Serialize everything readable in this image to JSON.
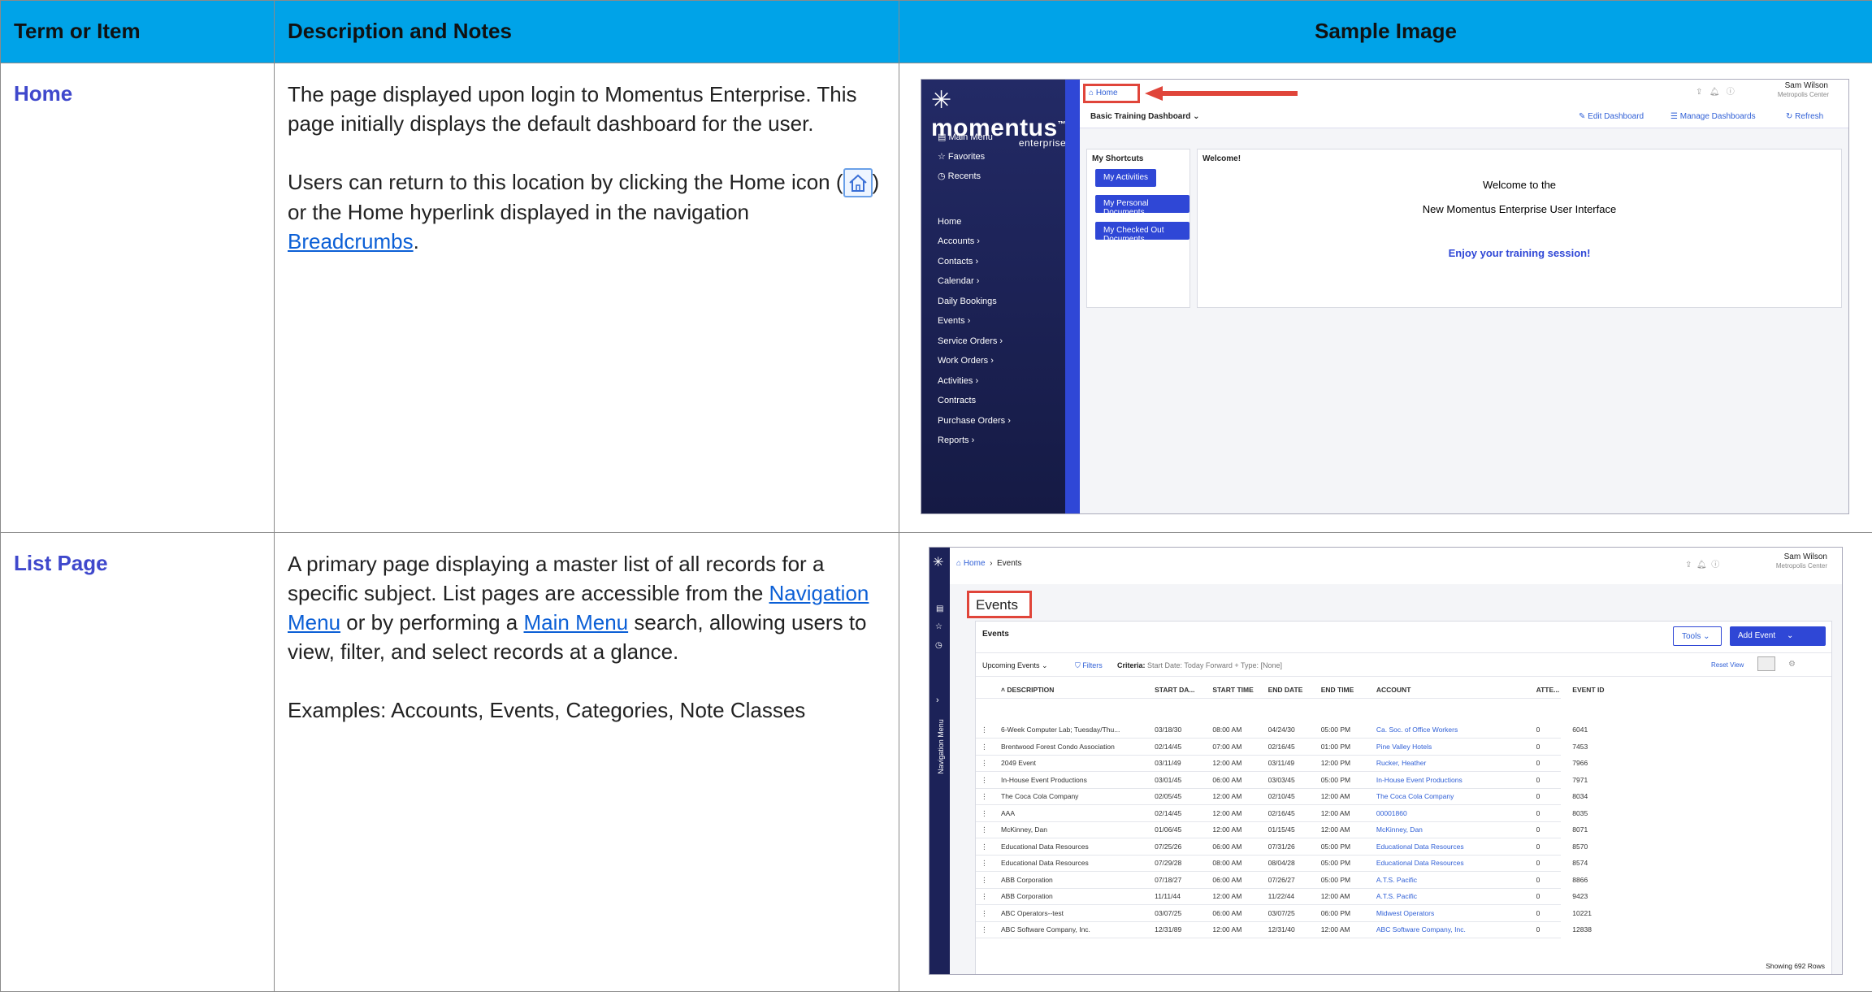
{
  "headers": {
    "term": "Term or Item",
    "desc": "Description and Notes",
    "sample": "Sample Image"
  },
  "rows": [
    {
      "term": "Home",
      "p1": "The page displayed upon login to Momentus Enterprise. This page initially displays the default dashboard for the user.",
      "p2_a": "Users can return to this location by clicking the Home icon (",
      "p2_b": ") or the Home hyperlink displayed in the navigation",
      "p2_link": "Breadcrumbs",
      "p2_end": "."
    },
    {
      "term": "List Page",
      "p1_a": "A primary page displaying a master list of all records for a specific subject. List pages are accessible from the",
      "p1_link1": "Navigation Menu",
      "p1_b": "or by performing a",
      "p1_link2": "Main Menu",
      "p1_c": "search, allowing users to view, filter, and select records at a glance.",
      "p2": "Examples:  Accounts, Events, Categories, Note Classes"
    }
  ],
  "shot1": {
    "logo": "momentus",
    "logo_tm": "™",
    "logo_sub": "enterprise",
    "top_menu": [
      "Main Menu",
      "Favorites",
      "Recents"
    ],
    "nav": [
      "Home",
      "Accounts  ›",
      "Contacts  ›",
      "Calendar  ›",
      "Daily Bookings",
      "Events  ›",
      "Service Orders  ›",
      "Work Orders  ›",
      "Activities  ›",
      "Contracts",
      "Purchase Orders  ›",
      "Reports  ›"
    ],
    "crumb": "Home",
    "dashboard": "Basic Training Dashboard",
    "edit": "Edit Dashboard",
    "manage": "Manage Dashboards",
    "refresh": "Refresh",
    "user": "Sam Wilson",
    "venue": "Metropolis Center",
    "shortcuts_title": "My Shortcuts",
    "shortcuts": [
      "My Activities",
      "My Personal Documents",
      "My Checked Out Documents"
    ],
    "welcome_title": "Welcome!",
    "welcome_1": "Welcome to the",
    "welcome_2": "New Momentus Enterprise User Interface",
    "welcome_3": "Enjoy your training session!"
  },
  "shot2": {
    "crumb_home": "Home",
    "crumb_events": "Events",
    "user": "Sam Wilson",
    "venue": "Metropolis Center",
    "title": "Events",
    "grid_title": "Events",
    "tools": "Tools",
    "add": "Add Event",
    "view": "Upcoming Events",
    "filters": "Filters",
    "criteria_label": "Criteria:",
    "criteria": "Start Date: Today Forward + Type: [None]",
    "reset": "Reset View",
    "nav_menu": "Navigation Menu",
    "columns": [
      "DESCRIPTION",
      "START DA...",
      "START TIME",
      "END DATE",
      "END TIME",
      "ACCOUNT",
      "ATTE...",
      "EVENT ID"
    ],
    "rows": [
      [
        "6-Week Computer Lab; Tuesday/Thu...",
        "03/18/30",
        "08:00 AM",
        "04/24/30",
        "05:00 PM",
        "Ca. Soc. of Office Workers",
        "0",
        "6041"
      ],
      [
        "Brentwood Forest Condo Association",
        "02/14/45",
        "07:00 AM",
        "02/16/45",
        "01:00 PM",
        "Pine Valley Hotels",
        "0",
        "7453"
      ],
      [
        "2049 Event",
        "03/11/49",
        "12:00 AM",
        "03/11/49",
        "12:00 PM",
        "Rucker, Heather",
        "0",
        "7966"
      ],
      [
        "In-House Event Productions",
        "03/01/45",
        "06:00 AM",
        "03/03/45",
        "05:00 PM",
        "In-House Event Productions",
        "0",
        "7971"
      ],
      [
        "The Coca Cola Company",
        "02/05/45",
        "12:00 AM",
        "02/10/45",
        "12:00 AM",
        "The Coca Cola Company",
        "0",
        "8034"
      ],
      [
        "AAA",
        "02/14/45",
        "12:00 AM",
        "02/16/45",
        "12:00 AM",
        "00001860",
        "0",
        "8035"
      ],
      [
        "McKinney, Dan",
        "01/06/45",
        "12:00 AM",
        "01/15/45",
        "12:00 AM",
        "McKinney, Dan",
        "0",
        "8071"
      ],
      [
        "Educational Data Resources",
        "07/25/26",
        "06:00 AM",
        "07/31/26",
        "05:00 PM",
        "Educational Data Resources",
        "0",
        "8570"
      ],
      [
        "Educational Data Resources",
        "07/29/28",
        "08:00 AM",
        "08/04/28",
        "05:00 PM",
        "Educational Data Resources",
        "0",
        "8574"
      ],
      [
        "ABB Corporation",
        "07/18/27",
        "06:00 AM",
        "07/26/27",
        "05:00 PM",
        "A.T.S. Pacific",
        "0",
        "8866"
      ],
      [
        "ABB Corporation",
        "11/11/44",
        "12:00 AM",
        "11/22/44",
        "12:00 AM",
        "A.T.S. Pacific",
        "0",
        "9423"
      ],
      [
        "ABC Operators--test",
        "03/07/25",
        "06:00 AM",
        "03/07/25",
        "06:00 PM",
        "Midwest Operators",
        "0",
        "10221"
      ],
      [
        "ABC Software Company, Inc.",
        "12/31/89",
        "12:00 AM",
        "12/31/40",
        "12:00 AM",
        "ABC Software Company, Inc.",
        "0",
        "12838"
      ]
    ],
    "footer": "Showing 692 Rows"
  }
}
